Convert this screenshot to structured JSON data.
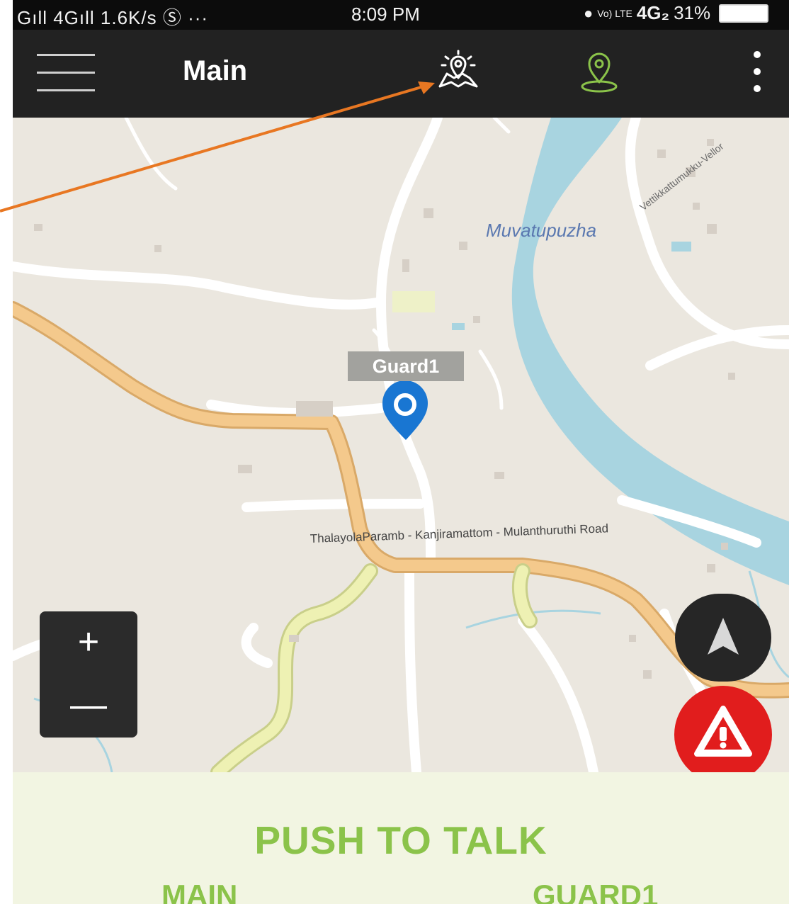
{
  "status_bar": {
    "left": "Gıll 4Gıll 1.6K/s Ⓢ ···",
    "time": "8:09 PM",
    "network": "4G₂",
    "lte": "Vo) LTE",
    "battery": "31%"
  },
  "app_bar": {
    "title": "Main",
    "icons": [
      "menu-icon",
      "map-area-icon",
      "location-pin-icon",
      "more-vertical-icon"
    ],
    "accent": "#8bc34a"
  },
  "map": {
    "place_labels": [
      "Muvatupuzha",
      "Vettikkattumukku-Vellor"
    ],
    "road_labels": [
      "ThalayolaParamb - Kanjiramattom - Mulanthuruthi Road"
    ],
    "marker_label": "Guard1",
    "controls": {
      "zoom_in": "+",
      "zoom_out": "—"
    },
    "colors": {
      "water": "#a8d4e0",
      "major_road": "#f4c98c",
      "minor_road": "#ffffff",
      "alert": "#e11d1d",
      "marker": "#1976d2"
    }
  },
  "push_to_talk": {
    "title": "PUSH TO TALK",
    "left_channel": "MAIN",
    "right_channel": "GUARD1"
  },
  "annotation": {
    "color": "#e87722"
  }
}
